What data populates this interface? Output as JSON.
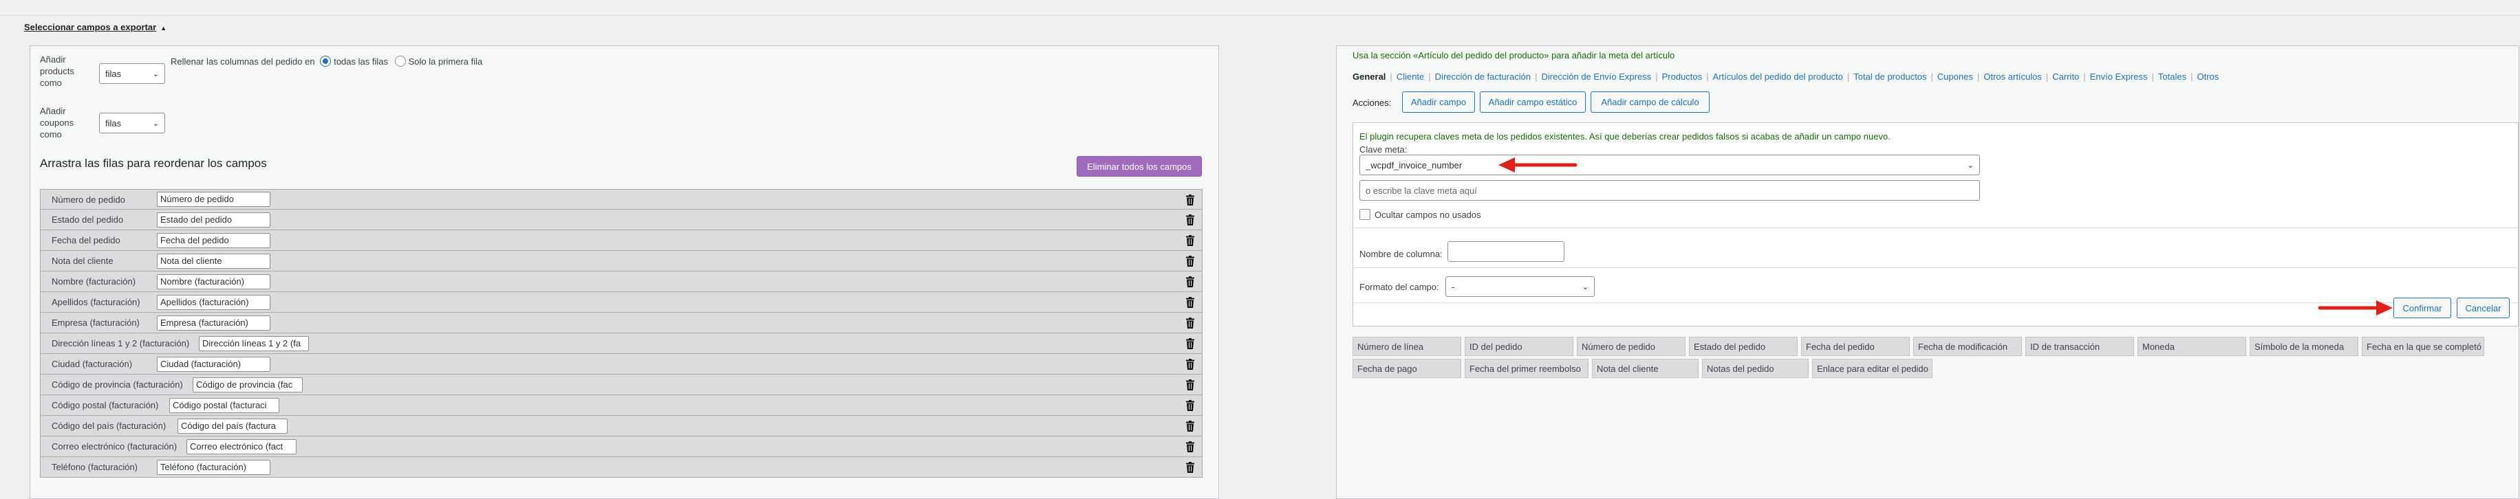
{
  "section_title": "Seleccionar campos a exportar",
  "left": {
    "products_label": [
      "Añadir",
      "products",
      "como"
    ],
    "products_select": "filas",
    "fill_columns_label": "Rellenar las columnas del pedido en",
    "radio_all": "todas las filas",
    "radio_first": "Solo la primera fila",
    "coupons_label": [
      "Añadir",
      "coupons",
      "como"
    ],
    "coupons_select": "filas",
    "drag_heading": "Arrastra las filas para reordenar los campos",
    "delete_all_button": "Eliminar todos los campos",
    "rows": [
      {
        "label": "Número de pedido",
        "value": "Número de pedido"
      },
      {
        "label": "Estado del pedido",
        "value": "Estado del pedido"
      },
      {
        "label": "Fecha del pedido",
        "value": "Fecha del pedido"
      },
      {
        "label": "Nota del cliente",
        "value": "Nota del cliente"
      },
      {
        "label": "Nombre (facturación)",
        "value": "Nombre (facturación)"
      },
      {
        "label": "Apellidos (facturación)",
        "value": "Apellidos (facturación)"
      },
      {
        "label": "Empresa (facturación)",
        "value": "Empresa (facturación)"
      },
      {
        "label": "Dirección líneas 1 y 2 (facturación)",
        "value": "Dirección líneas 1 y 2 (fa"
      },
      {
        "label": "Ciudad (facturación)",
        "value": "Ciudad (facturación)"
      },
      {
        "label": "Código de provincia (facturación)",
        "value": "Código de provincia (fac"
      },
      {
        "label": "Código postal (facturación)",
        "value": "Código postal (facturaci"
      },
      {
        "label": "Código del país (facturación)",
        "value": "Código del país (factura"
      },
      {
        "label": "Correo electrónico (facturación)",
        "value": "Correo electrónico (fact"
      },
      {
        "label": "Teléfono (facturación)",
        "value": "Teléfono (facturación)"
      }
    ]
  },
  "right": {
    "notice": "Usa la sección «Artículo del pedido del producto» para añadir la meta del artículo",
    "tabs": [
      "General",
      "Cliente",
      "Dirección de facturación",
      "Dirección de Envío Express",
      "Productos",
      "Artículos del pedido del producto",
      "Total de productos",
      "Cupones",
      "Otros artículos",
      "Carrito",
      "Envío Express",
      "Totales",
      "Otros"
    ],
    "actions_label": "Acciones:",
    "add_field": "Añadir campo",
    "add_static_field": "Añadir campo estático",
    "add_calc_field": "Añadir campo de cálculo",
    "plugin_notice": "El plugin recupera claves meta de los pedidos existentes. Así que deberías crear pedidos falsos si acabas de añadir un campo nuevo.",
    "meta_key_label": "Clave meta:",
    "meta_key_value": "_wcpdf_invoice_number",
    "meta_key_placeholder": "o escribe la clave meta aquí",
    "hide_unused": "Ocultar campos no usados",
    "column_name_label": "Nombre de columna:",
    "column_name_value": "",
    "field_format_label": "Formato del campo:",
    "field_format_value": "-",
    "confirm_button": "Confirmar",
    "cancel_button": "Cancelar",
    "field_tags": [
      [
        "Número de línea",
        "ID del pedido",
        "Número de pedido",
        "Estado del pedido",
        "Fecha del pedido",
        "Fecha de modificación",
        "ID de transacción",
        "Moneda",
        "Símbolo de la moneda",
        "Fecha en la que se completó"
      ],
      [
        "Fecha de pago",
        "Fecha del primer reembolso",
        "Nota del cliente",
        "Notas del pedido",
        "Enlace para editar el pedido"
      ]
    ]
  },
  "colors": {
    "accent": "#2271b1",
    "purple": "#a16bbd",
    "notice_green": "#1b6a0c",
    "arrow_red": "#e0201b"
  }
}
